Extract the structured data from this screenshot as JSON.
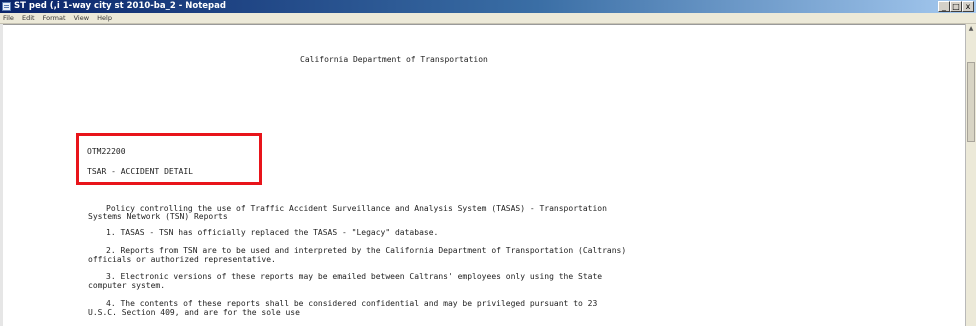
{
  "window": {
    "title": "ST ped (,i 1-way city st 2010-ba_2 - Notepad",
    "buttons": {
      "minimize": "_",
      "maximize": "□",
      "close": "x"
    }
  },
  "menu": [
    "File",
    "Edit",
    "Format",
    "View",
    "Help"
  ],
  "document": {
    "heading": "California Department of Transportation",
    "code": "OTM22200",
    "subtitle": "TSAR - ACCIDENT DETAIL",
    "policy_line1": "Policy controlling the use of Traffic Accident Surveillance and Analysis System (TASAS) - Transportation",
    "policy_line2": "Systems Network (TSN) Reports",
    "item1": "1. TASAS - TSN has officially replaced the TASAS - \"Legacy\" database.",
    "item2_line1": "2. Reports from TSN are to be used and interpreted by the California Department of Transportation (Caltrans)",
    "item2_line2": "officials or authorized representative.",
    "item3_line1": "3. Electronic versions of these reports may be emailed between Caltrans' employees only using the State",
    "item3_line2": "computer system.",
    "item4_line1": "4. The contents of these reports shall be considered confidential and may be privileged pursuant to 23",
    "item4_line2": "U.S.C. Section 409, and are for the sole use"
  },
  "highlight_color": "#e8141a"
}
